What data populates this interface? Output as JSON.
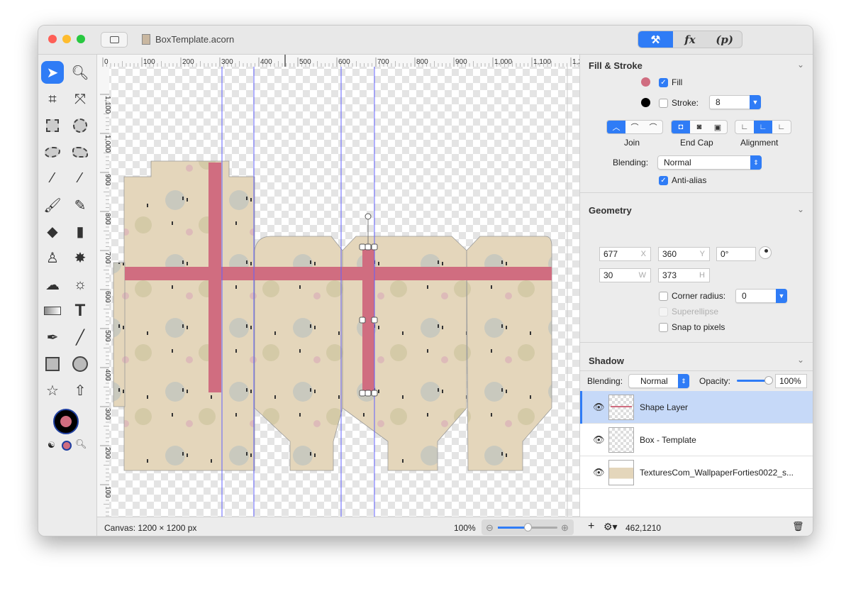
{
  "window": {
    "title": "BoxTemplate.acorn"
  },
  "inspector_tabs": [
    {
      "label": "tools",
      "icon": "hammer-brush-icon",
      "active": true
    },
    {
      "label": "fx"
    },
    {
      "label": "(p)"
    }
  ],
  "tools": [
    "select-arrow",
    "zoom",
    "crop",
    "transform",
    "rect-select",
    "ellipse-select",
    "lasso",
    "polygon-lasso",
    "magic-wand",
    "instant-alpha",
    "brush",
    "pencil",
    "paint-bucket",
    "eraser",
    "clone-stamp",
    "smudge",
    "cloud",
    "dodge-burn",
    "gradient",
    "text",
    "pen",
    "line",
    "rectangle",
    "oval",
    "star",
    "arrow"
  ],
  "colors": {
    "fill": "#d06d80",
    "stroke": "#000000",
    "accent": "#2f7cf6",
    "guide": "#5b5bff"
  },
  "fill_stroke": {
    "title": "Fill & Stroke",
    "fill_label": "Fill",
    "fill_checked": true,
    "stroke_label": "Stroke:",
    "stroke_checked": false,
    "stroke_width": "8",
    "join_label": "Join",
    "endcap_label": "End Cap",
    "alignment_label": "Alignment",
    "blending_label": "Blending:",
    "blending_value": "Normal",
    "antialias_label": "Anti-alias",
    "antialias_checked": true
  },
  "geometry": {
    "title": "Geometry",
    "x": "677",
    "x_unit": "X",
    "y": "360",
    "y_unit": "Y",
    "rotation": "0°",
    "w": "30",
    "w_unit": "W",
    "h": "373",
    "h_unit": "H",
    "corner_radius_label": "Corner radius:",
    "corner_radius": "0",
    "superellipse_label": "Superellipse",
    "snap_label": "Snap to pixels"
  },
  "shadow": {
    "title": "Shadow",
    "blending_label": "Blending:",
    "blending_value": "Normal",
    "opacity_label": "Opacity:",
    "opacity_value": "100%",
    "opacity": 100
  },
  "layers": [
    {
      "name": "Shape Layer",
      "selected": true
    },
    {
      "name": "Box - Template",
      "selected": false
    },
    {
      "name": "TexturesCom_WallpaperForties0022_s...",
      "selected": false
    }
  ],
  "ruler_h": [
    "0",
    "100",
    "200",
    "300",
    "400",
    "500",
    "600",
    "700",
    "800",
    "900",
    "1,000",
    "1,100",
    "1,2"
  ],
  "ruler_v": [
    "1,100",
    "1,000",
    "900",
    "800",
    "700",
    "600",
    "500",
    "400",
    "300",
    "200",
    "100"
  ],
  "status": {
    "canvas": "Canvas: 1200 × 1200 px",
    "zoom": "100%",
    "zoom_level": 0.5,
    "coords": "462,1210"
  }
}
